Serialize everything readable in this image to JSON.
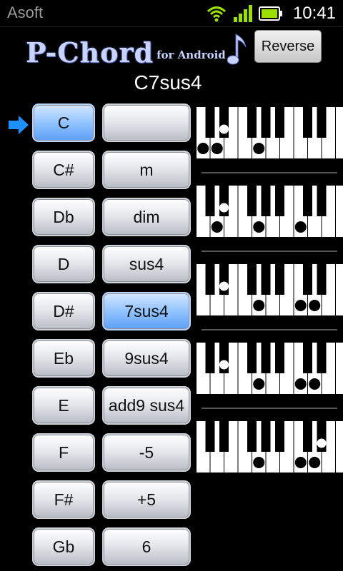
{
  "status_bar": {
    "carrier": "Asoft",
    "time": "10:41",
    "icons": [
      "wifi-icon",
      "signal-icon",
      "battery-icon"
    ]
  },
  "header": {
    "logo_main": "P-Chord",
    "logo_sub": "for Android",
    "reverse_label": "Reverse"
  },
  "chord_name": "C7sus4",
  "roots": [
    "C",
    "C#",
    "Db",
    "D",
    "D#",
    "Eb",
    "E",
    "F",
    "F#",
    "Gb"
  ],
  "selected_root_index": 0,
  "types": [
    "",
    "m",
    "dim",
    "sus4",
    "7sus4",
    "9sus4",
    "add9 sus4",
    "-5",
    "+5",
    "6"
  ],
  "selected_type_index": 4,
  "colors": {
    "selected": "#8cc0ff",
    "logo": "#c8d4ff",
    "arrow": "#1e90ff"
  },
  "keyboards": [
    {
      "name": "voicing-1",
      "dots": [
        {
          "key": "w",
          "i": 0
        },
        {
          "key": "w",
          "i": 1
        },
        {
          "key": "b",
          "i": 2
        },
        {
          "key": "w",
          "i": 4
        }
      ]
    },
    {
      "name": "voicing-2",
      "dots": [
        {
          "key": "w",
          "i": 1
        },
        {
          "key": "b",
          "i": 2
        },
        {
          "key": "w",
          "i": 4
        },
        {
          "key": "w",
          "i": 7
        }
      ]
    },
    {
      "name": "voicing-3",
      "dots": [
        {
          "key": "b",
          "i": 2
        },
        {
          "key": "w",
          "i": 4
        },
        {
          "key": "w",
          "i": 7
        },
        {
          "key": "w",
          "i": 8
        }
      ]
    },
    {
      "name": "voicing-4",
      "dots": [
        {
          "key": "b",
          "i": 2
        },
        {
          "key": "w",
          "i": 4
        },
        {
          "key": "w",
          "i": 7
        },
        {
          "key": "w",
          "i": 8
        }
      ]
    },
    {
      "name": "voicing-5",
      "dots": [
        {
          "key": "w",
          "i": 4
        },
        {
          "key": "w",
          "i": 7
        },
        {
          "key": "w",
          "i": 8
        },
        {
          "key": "b",
          "i": 9
        }
      ]
    }
  ]
}
